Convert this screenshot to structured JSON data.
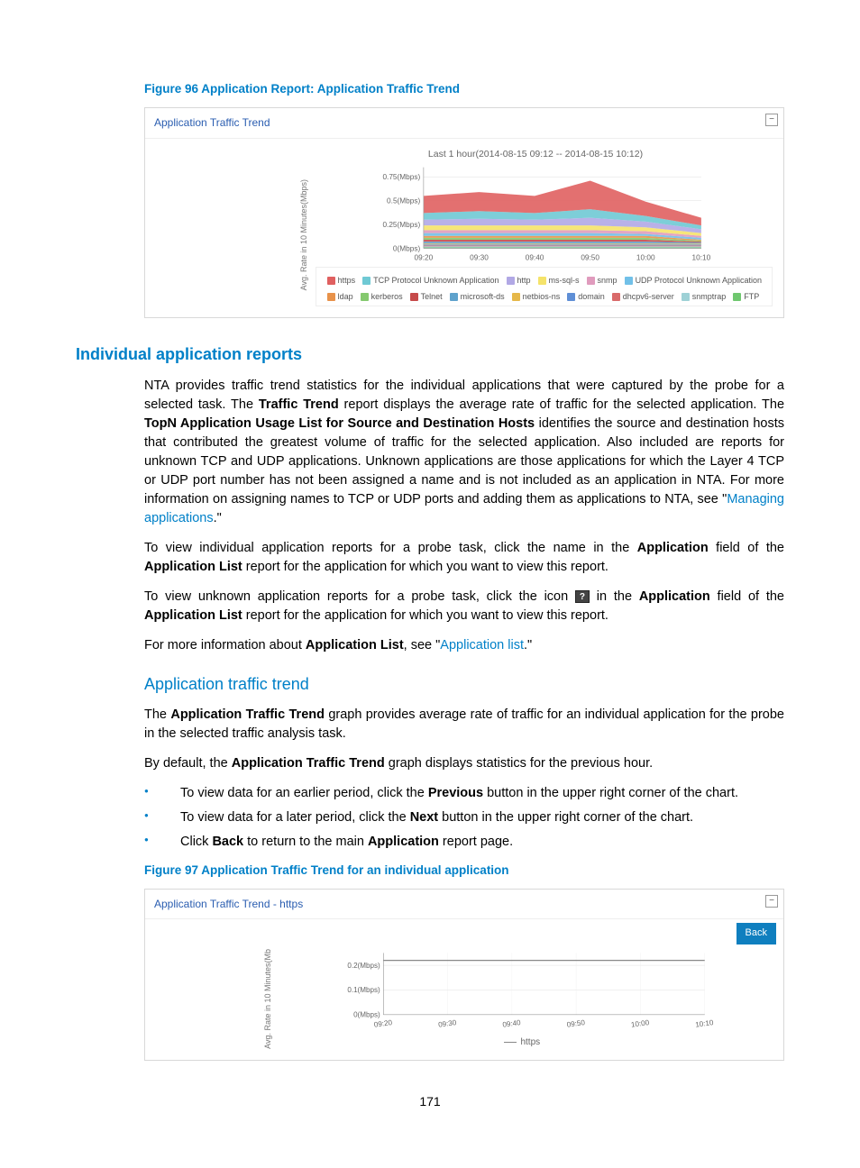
{
  "figure96": {
    "caption": "Figure 96 Application Report: Application Traffic Trend",
    "panel_title": "Application Traffic Trend",
    "chart_title": "Last 1 hour(2014-08-15 09:12 -- 2014-08-15 10:12)",
    "y_axis_label": "Avg. Rate in 10 Minutes(Mbps)",
    "collapse_label": "−"
  },
  "chart_data": [
    {
      "id": "fig96",
      "type": "area",
      "title": "Last 1 hour(2014-08-15 09:12 -- 2014-08-15 10:12)",
      "xlabel": "",
      "ylabel": "Avg. Rate in 10 Minutes(Mbps)",
      "x": [
        "09:20",
        "09:30",
        "09:40",
        "09:50",
        "10:00",
        "10:10"
      ],
      "y_ticks": [
        "0(Mbps)",
        "0.25(Mbps)",
        "0.5(Mbps)",
        "0.75(Mbps)"
      ],
      "ylim": [
        0,
        0.85
      ],
      "series": [
        {
          "name": "https",
          "color": "#e06060",
          "values": [
            0.18,
            0.2,
            0.18,
            0.3,
            0.15,
            0.08
          ]
        },
        {
          "name": "TCP Protocol Unknown Application",
          "color": "#6fc9d4",
          "values": [
            0.07,
            0.08,
            0.07,
            0.09,
            0.06,
            0.04
          ]
        },
        {
          "name": "http",
          "color": "#b1a8e5",
          "values": [
            0.06,
            0.07,
            0.06,
            0.08,
            0.06,
            0.04
          ]
        },
        {
          "name": "ms-sql-s",
          "color": "#f5e36a",
          "values": [
            0.05,
            0.05,
            0.05,
            0.05,
            0.04,
            0.03
          ]
        },
        {
          "name": "snmp",
          "color": "#e09bbd",
          "values": [
            0.03,
            0.03,
            0.03,
            0.03,
            0.03,
            0.02
          ]
        },
        {
          "name": "UDP Protocol Unknown Application",
          "color": "#71c0e8",
          "values": [
            0.03,
            0.03,
            0.03,
            0.03,
            0.02,
            0.02
          ]
        },
        {
          "name": "ldap",
          "color": "#e8924a",
          "values": [
            0.02,
            0.02,
            0.02,
            0.02,
            0.02,
            0.01
          ]
        },
        {
          "name": "kerberos",
          "color": "#85c96f",
          "values": [
            0.02,
            0.02,
            0.02,
            0.02,
            0.02,
            0.01
          ]
        },
        {
          "name": "Telnet",
          "color": "#c64a4a",
          "values": [
            0.02,
            0.02,
            0.02,
            0.02,
            0.02,
            0.01
          ]
        },
        {
          "name": "microsoft-ds",
          "color": "#5fa2cc",
          "values": [
            0.02,
            0.02,
            0.02,
            0.02,
            0.02,
            0.01
          ]
        },
        {
          "name": "netbios-ns",
          "color": "#e6b84a",
          "values": [
            0.01,
            0.01,
            0.01,
            0.01,
            0.01,
            0.01
          ]
        },
        {
          "name": "domain",
          "color": "#5f8fd6",
          "values": [
            0.01,
            0.01,
            0.01,
            0.01,
            0.01,
            0.01
          ]
        },
        {
          "name": "dhcpv6-server",
          "color": "#d96a6a",
          "values": [
            0.01,
            0.01,
            0.01,
            0.01,
            0.01,
            0.01
          ]
        },
        {
          "name": "snmptrap",
          "color": "#9ed1d6",
          "values": [
            0.01,
            0.01,
            0.01,
            0.01,
            0.01,
            0.01
          ]
        },
        {
          "name": "FTP",
          "color": "#6fc76f",
          "values": [
            0.01,
            0.01,
            0.01,
            0.01,
            0.01,
            0.01
          ]
        }
      ]
    },
    {
      "id": "fig97",
      "type": "line",
      "title": "",
      "xlabel": "",
      "ylabel": "Avg. Rate in 10 Minutes(Mb",
      "x": [
        "09:20",
        "09:30",
        "09:40",
        "09:50",
        "10:00",
        "10:10"
      ],
      "y_ticks": [
        "0(Mbps)",
        "0.1(Mbps)",
        "0.2(Mbps)"
      ],
      "ylim": [
        0,
        0.25
      ],
      "series": [
        {
          "name": "https",
          "color": "#888888",
          "values": [
            0.22,
            0.22,
            0.22,
            0.22,
            0.22,
            0.22
          ]
        }
      ]
    }
  ],
  "section_heading": "Individual application reports",
  "para1_pre": "NTA provides traffic trend statistics for the individual applications that were captured by the probe for a selected task. The ",
  "para1_b1": "Traffic Trend",
  "para1_mid1": " report displays the average rate of traffic for the selected application. The ",
  "para1_b2": "TopN Application Usage List for Source and Destination Hosts",
  "para1_mid2": " identifies the source and destination hosts that contributed the greatest volume of traffic for the selected application. Also included are reports for unknown TCP and UDP applications. Unknown applications are those applications for which the Layer 4 TCP or UDP port number has not been assigned a name and is not included as an application in NTA. For more information on assigning names to TCP or UDP ports and adding them as applications to NTA, see \"",
  "para1_link": "Managing applications",
  "para1_end": ".\"",
  "para2_pre": "To view individual application reports for a probe task, click the name in the ",
  "para2_b1": "Application",
  "para2_mid": " field of the ",
  "para2_b2": "Application List",
  "para2_end": " report for the application for which you want to view this report.",
  "para3_pre": "To view unknown application reports for a probe task, click the icon ",
  "para3_icon": "?",
  "para3_mid1": " in the ",
  "para3_b1": "Application",
  "para3_mid2": " field of the ",
  "para3_b2": "Application List",
  "para3_end": " report for the application for which you want to view this report.",
  "para4_pre": "For more information about ",
  "para4_b1": "Application List",
  "para4_mid": ", see \"",
  "para4_link": "Application list",
  "para4_end": ".\"",
  "subsection_heading": "Application traffic trend",
  "para5_pre": "The ",
  "para5_b1": "Application Traffic Trend",
  "para5_end": " graph provides average rate of traffic for an individual application for the probe in the selected traffic analysis task.",
  "para6_pre": "By default, the ",
  "para6_b1": "Application Traffic Trend",
  "para6_end": " graph displays statistics for the previous hour.",
  "bullets": {
    "b1_pre": "To view data for an earlier period, click the ",
    "b1_b": "Previous",
    "b1_end": " button in the upper right corner of the chart.",
    "b2_pre": "To view data for a later period, click the ",
    "b2_b": "Next",
    "b2_end": " button in the upper right corner of the chart.",
    "b3_pre": "Click ",
    "b3_b1": "Back",
    "b3_mid": " to return to the main ",
    "b3_b2": "Application",
    "b3_end": " report page."
  },
  "figure97": {
    "caption": "Figure 97 Application Traffic Trend for an individual application",
    "panel_title": "Application Traffic Trend - https",
    "back_label": "Back",
    "collapse_label": "−",
    "y_axis_label": "Avg. Rate in 10 Minutes(Mb"
  },
  "page_number": "171"
}
